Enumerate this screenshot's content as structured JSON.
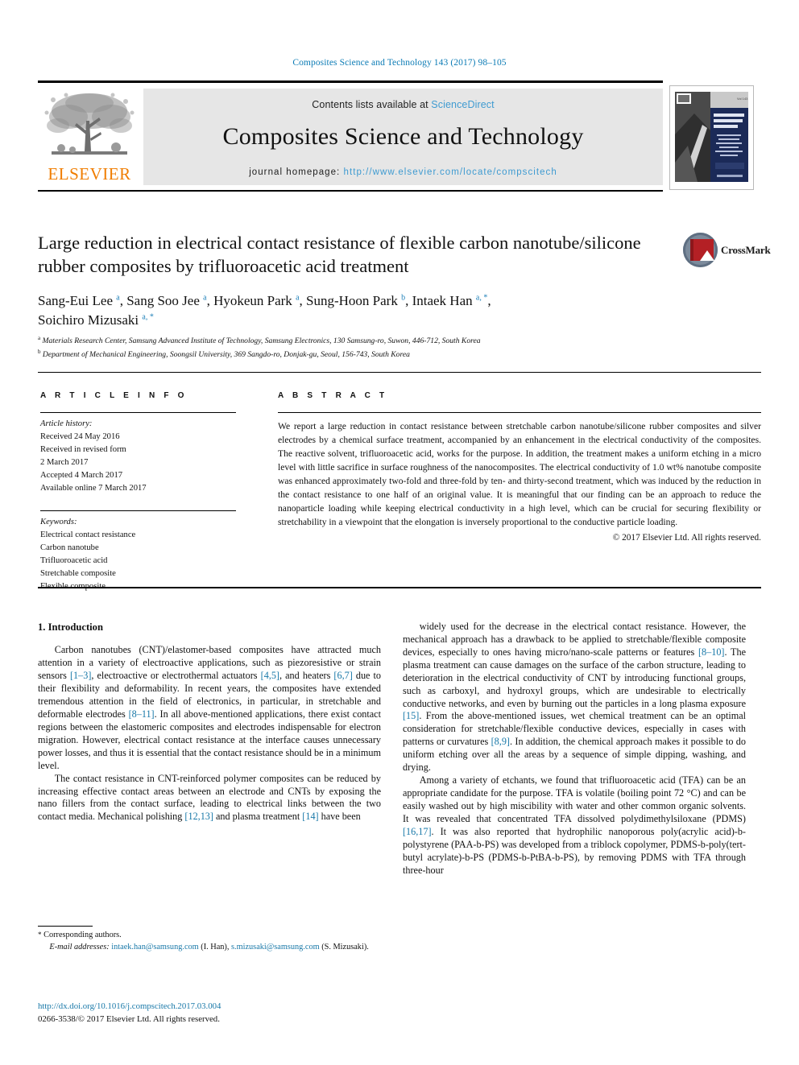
{
  "running_head": "Composites Science and Technology 143 (2017) 98–105",
  "masthead": {
    "contents_prefix": "Contents lists available at ",
    "sciencedirect": "ScienceDirect",
    "journal_name": "Composites Science and Technology",
    "homepage_prefix": "journal homepage: ",
    "homepage_url": "http://www.elsevier.com/locate/compscitech",
    "publisher_logo_text": "ELSEVIER",
    "cover_title_line1": "COMPOSITES",
    "cover_title_line2": "SCIENCE AND",
    "cover_title_line3": "TECHNOLOGY"
  },
  "article": {
    "title": "Large reduction in electrical contact resistance of flexible carbon nanotube/silicone rubber composites by trifluoroacetic acid treatment",
    "crossmark_label": "CrossMark",
    "authors_line1_parts": [
      {
        "name": "Sang-Eui Lee",
        "sup": "a"
      },
      {
        "name": "Sang Soo Jee",
        "sup": "a"
      },
      {
        "name": "Hyokeun Park",
        "sup": "a"
      },
      {
        "name": "Sung-Hoon Park",
        "sup": "b"
      },
      {
        "name": "Intaek Han",
        "sup": "a, *"
      }
    ],
    "authors_line2_parts": [
      {
        "name": "Soichiro Mizusaki",
        "sup": "a, *"
      }
    ],
    "affiliations": [
      {
        "marker": "a",
        "text": "Materials Research Center, Samsung Advanced Institute of Technology, Samsung Electronics, 130 Samsung-ro, Suwon, 446-712, South Korea"
      },
      {
        "marker": "b",
        "text": "Department of Mechanical Engineering, Soongsil University, 369 Sangdo-ro, Donjak-gu, Seoul, 156-743, South Korea"
      }
    ]
  },
  "article_info": {
    "heading": "A R T I C L E   I N F O",
    "history_label": "Article history:",
    "history": [
      "Received 24 May 2016",
      "Received in revised form",
      "2 March 2017",
      "Accepted 4 March 2017",
      "Available online 7 March 2017"
    ],
    "keywords_label": "Keywords:",
    "keywords": [
      "Electrical contact resistance",
      "Carbon nanotube",
      "Trifluoroacetic acid",
      "Stretchable composite",
      "Flexible composite"
    ]
  },
  "abstract": {
    "heading": "A B S T R A C T",
    "text": "We report a large reduction in contact resistance between stretchable carbon nanotube/silicone rubber composites and silver electrodes by a chemical surface treatment, accompanied by an enhancement in the electrical conductivity of the composites. The reactive solvent, trifluoroacetic acid, works for the purpose. In addition, the treatment makes a uniform etching in a micro level with little sacrifice in surface roughness of the nanocomposites. The electrical conductivity of 1.0 wt% nanotube composite was enhanced approximately two-fold and three-fold by ten- and thirty-second treatment, which was induced by the reduction in the contact resistance to one half of an original value. It is meaningful that our finding can be an approach to reduce the nanoparticle loading while keeping electrical conductivity in a high level, which can be crucial for securing flexibility or stretchability in a viewpoint that the elongation is inversely proportional to the conductive particle loading.",
    "copyright": "© 2017 Elsevier Ltd. All rights reserved."
  },
  "body": {
    "section_title": "1. Introduction",
    "left_paragraphs": [
      "Carbon nanotubes (CNT)/elastomer-based composites have attracted much attention in a variety of electroactive applications, such as piezoresistive or strain sensors [1–3], electroactive or electrothermal actuators [4,5], and heaters [6,7] due to their flexibility and deformability. In recent years, the composites have extended tremendous attention in the field of electronics, in particular, in stretchable and deformable electrodes [8–11]. In all above-mentioned applications, there exist contact regions between the elastomeric composites and electrodes indispensable for electron migration. However, electrical contact resistance at the interface causes unnecessary power losses, and thus it is essential that the contact resistance should be in a minimum level.",
      "The contact resistance in CNT-reinforced polymer composites can be reduced by increasing effective contact areas between an electrode and CNTs by exposing the nano fillers from the contact surface, leading to electrical links between the two contact media. Mechanical polishing [12,13] and plasma treatment [14] have been"
    ],
    "right_paragraphs": [
      "widely used for the decrease in the electrical contact resistance. However, the mechanical approach has a drawback to be applied to stretchable/flexible composite devices, especially to ones having micro/nano-scale patterns or features [8–10]. The plasma treatment can cause damages on the surface of the carbon structure, leading to deterioration in the electrical conductivity of CNT by introducing functional groups, such as carboxyl, and hydroxyl groups, which are undesirable to electrically conductive networks, and even by burning out the particles in a long plasma exposure [15]. From the above-mentioned issues, wet chemical treatment can be an optimal consideration for stretchable/flexible conductive devices, especially in cases with patterns or curvatures [8,9]. In addition, the chemical approach makes it possible to do uniform etching over all the areas by a sequence of simple dipping, washing, and drying.",
      "Among a variety of etchants, we found that trifluoroacetic acid (TFA) can be an appropriate candidate for the purpose. TFA is volatile (boiling point 72 °C) and can be easily washed out by high miscibility with water and other common organic solvents. It was revealed that concentrated TFA dissolved polydimethylsiloxane (PDMS) [16,17]. It was also reported that hydrophilic nanoporous poly(acrylic acid)-b-polystyrene (PAA-b-PS) was developed from a triblock copolymer, PDMS-b-poly(tert-butyl acrylate)-b-PS (PDMS-b-PtBA-b-PS), by removing PDMS with TFA through three-hour"
    ]
  },
  "footnotes": {
    "corresponding_marker": "*",
    "corresponding_text": "Corresponding authors.",
    "email_label": "E-mail addresses:",
    "email1": "intaek.han@samsung.com",
    "email1_owner": "(I. Han),",
    "email2": "s.mizusaki@samsung.com",
    "email2_owner": "(S. Mizusaki)."
  },
  "publication": {
    "doi": "http://dx.doi.org/10.1016/j.compscitech.2017.03.004",
    "issn_line": "0266-3538/© 2017 Elsevier Ltd. All rights reserved."
  },
  "colors": {
    "link_blue": "#1878a8",
    "heading_blue": "#0b7bb5",
    "sciencedirect_blue": "#3f9bd1",
    "elsevier_orange": "#f07d00",
    "band_gray": "#e6e6e6"
  }
}
